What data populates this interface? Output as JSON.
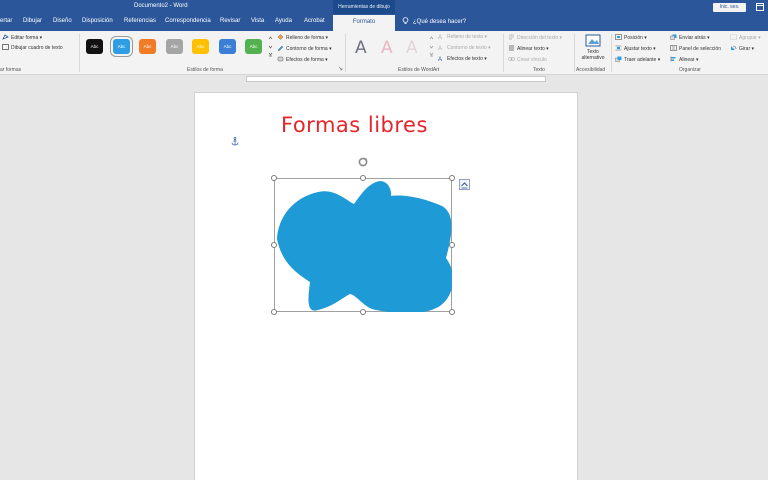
{
  "titlebar": {
    "title": "Documento2  -  Word",
    "context_header": "Herramientas de dibujo",
    "signin": "Inic. ses."
  },
  "tabs": {
    "items": [
      {
        "label": "ertar"
      },
      {
        "label": "Dibujar"
      },
      {
        "label": "Diseño"
      },
      {
        "label": "Disposición"
      },
      {
        "label": "Referencias"
      },
      {
        "label": "Correspondencia"
      },
      {
        "label": "Revisar"
      },
      {
        "label": "Vista"
      },
      {
        "label": "Ayuda"
      },
      {
        "label": "Acrobat"
      }
    ],
    "active": "Formato",
    "tell_me": "¿Qué desea hacer?"
  },
  "ribbon": {
    "insert_shapes": {
      "edit_shape": "Editar forma",
      "draw_textbox": "Dibujar cuadro de texto",
      "label": "ar formas"
    },
    "shape_styles": {
      "swatch_text": "Abc",
      "swatches": [
        "#111111",
        "#2e9de4",
        "#f07c28",
        "#a5a5a5",
        "#ffc000",
        "#3a7fd5",
        "#53b14f"
      ],
      "fill": "Relleno de forma",
      "outline": "Contorno de forma",
      "effects": "Efectos de forma",
      "label": "Estilos de forma"
    },
    "wordart": {
      "letter": "A",
      "text_fill": "Relleno de texto",
      "text_outline": "Contorno de texto",
      "text_effects": "Efectos de texto",
      "label": "Estilos de WordArt"
    },
    "text": {
      "direction": "Dirección del texto",
      "align": "Alinear texto",
      "link": "Crear vínculo",
      "label": "Texto"
    },
    "accessibility": {
      "alt_text_line1": "Texto",
      "alt_text_line2": "alternativo",
      "label": "Accesibilidad"
    },
    "arrange": {
      "position": "Posición",
      "wrap": "Ajustar texto",
      "forward": "Traer adelante",
      "backward": "Enviar atrás",
      "selection_pane": "Panel de selección",
      "align": "Alinear",
      "group": "Agrupar",
      "rotate": "Girar",
      "label": "Organizar"
    }
  },
  "document": {
    "heading": "Formas libres",
    "shape_color": "#1e9ad6"
  }
}
